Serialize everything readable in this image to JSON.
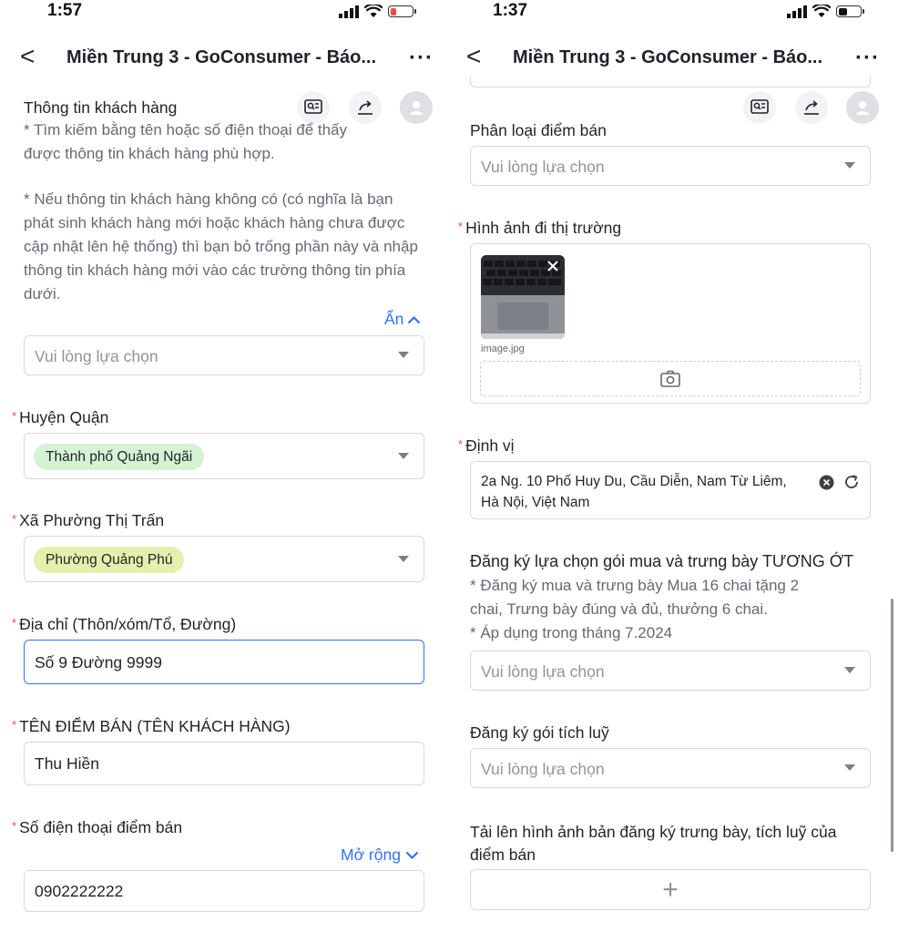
{
  "colors": {
    "accent": "#3370ff",
    "required": "#f54a45",
    "tag_green": "#d6f2d5",
    "tag_yellow": "#e5f0ad",
    "battery_low": "#f54a45"
  },
  "left": {
    "status": {
      "time": "1:57"
    },
    "nav": {
      "back": "<",
      "title": "Miền Trung 3 - GoConsumer - Báo...",
      "more": "···"
    },
    "customer_info": {
      "label": "Thông tin khách hàng",
      "hint1": "* Tìm kiếm bằng tên hoặc số điện thoại để thấy được thông tin khách hàng phù hợp.",
      "hint2": "* Nếu thông tin khách hàng không có (có nghĩa là bạn phát sinh khách hàng mới hoặc khách hàng chưa được cập nhật lên hệ thống) thì bạn bỏ trống phần này và nhập thông tin khách hàng mới vào các trường thông tin phía dưới.",
      "collapse_label": "Ẩn",
      "placeholder": "Vui lòng lựa chọn"
    },
    "district": {
      "label": "Huyện Quận",
      "value": "Thành phố Quảng Ngãi"
    },
    "ward": {
      "label": "Xã Phường Thị Trấn",
      "value": "Phường Quảng Phú"
    },
    "address": {
      "label": "Địa chỉ (Thôn/xóm/Tổ, Đường)",
      "value": "Số 9 Đường 9999"
    },
    "store_name": {
      "label": "TÊN ĐIỂM BÁN (TÊN KHÁCH HÀNG)",
      "value": "Thu Hiền"
    },
    "phone": {
      "label": "Số điện thoại điểm bán",
      "expand_label": "Mở rộng",
      "value": "0902222222"
    }
  },
  "right": {
    "status": {
      "time": "1:37"
    },
    "nav": {
      "back": "<",
      "title": "Miền Trung 3 - GoConsumer - Báo...",
      "more": "···"
    },
    "store_type": {
      "label": "Phân loại điểm bán",
      "placeholder": "Vui lòng lựa chọn"
    },
    "market_photo": {
      "label": "Hình ảnh đi thị trường",
      "file_name": "image.jpg"
    },
    "location": {
      "label": "Định vị",
      "value_line1": "2a Ng. 10 Phố Huy Du, Cầu Diễn, Nam Từ Liêm,",
      "value_line2": "Hà Nội, Việt Nam"
    },
    "package": {
      "label": "Đăng ký lựa chọn gói mua và trưng bày TƯƠNG ỚT",
      "hint_line1": "* Đăng ký mua và trưng bày Mua 16 chai tặng 2",
      "hint_line2": "chai, Trưng bày đúng và đủ, thưởng 6 chai.",
      "hint_line3": "* Áp dụng trong tháng 7.2024",
      "placeholder": "Vui lòng lựa chọn"
    },
    "accumulate": {
      "label": "Đăng ký gói tích luỹ",
      "placeholder": "Vui lòng lựa chọn"
    },
    "upload": {
      "label_line1": "Tải lên hình ảnh bản đăng ký trưng bày, tích luỹ của",
      "label_line2": "điểm bán",
      "add": "+"
    }
  }
}
